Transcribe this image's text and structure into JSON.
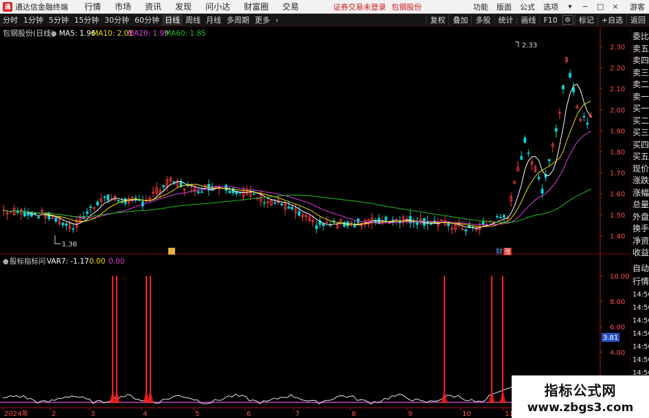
{
  "window": {
    "app_title": "通达信金融终端",
    "menu": [
      "行情",
      "市场",
      "资讯",
      "发现",
      "问小达",
      "财富圈",
      "交易"
    ],
    "notice": "证券交易未登录",
    "stock_name": "包钢股份",
    "right_menu": [
      "功能",
      "版面",
      "公式",
      "选项"
    ],
    "guest_label": "游客"
  },
  "toolbar": {
    "periods": [
      "分时",
      "1分钟",
      "5分钟",
      "15分钟",
      "30分钟",
      "60分钟",
      "日线",
      "周线",
      "月线",
      "多周期",
      "更多"
    ],
    "active_period": "日线",
    "right_buttons": [
      "复权",
      "叠加",
      "多股",
      "统计",
      "画线",
      "F10",
      "标记",
      "+自选",
      "返回"
    ]
  },
  "price_chart": {
    "header_name": "包钢股份(日线)",
    "ma_labels": [
      {
        "text": "MA5: 1.96",
        "color": "#ffffff"
      },
      {
        "text": "MA10: 2.01",
        "color": "#f0e000"
      },
      {
        "text": "MA20: 1.99",
        "color": "#e040e0"
      },
      {
        "text": "MA60: 1.85",
        "color": "#20c020"
      }
    ],
    "high_label": "2.33",
    "low_label": "1.36",
    "y_ticks": [
      "2.30",
      "2.20",
      "2.10",
      "2.00",
      "1.90",
      "1.80",
      "1.70",
      "1.60",
      "1.50",
      "1.40"
    ],
    "event_badges": [
      "财",
      "涨"
    ]
  },
  "indicator_chart": {
    "header_name": "股标指标问",
    "var_label": "VAR7: -1.17",
    "val2": "0.00",
    "val3": "0.00",
    "y_ticks": [
      "10.00",
      "8.00",
      "6.00",
      "4.00",
      "2.00"
    ],
    "current_value": "3.81",
    "x_ticks": [
      "2024年",
      "2",
      "3",
      "4",
      "5",
      "6",
      "7",
      "8",
      "9",
      "10",
      "11"
    ]
  },
  "side_panel": {
    "items": [
      "委比",
      "卖五",
      "卖四",
      "卖三",
      "卖二",
      "卖一",
      "买一",
      "买二",
      "买三",
      "买四",
      "买五",
      "现价",
      "涨跌",
      "涨幅",
      "总量",
      "外盘",
      "换手",
      "净资",
      "收益"
    ],
    "lower_items": [
      "自动",
      "行情",
      "14:50",
      "14:50",
      "14:50",
      "14:50",
      "14:50",
      "14:50",
      "14:50",
      "14:50"
    ]
  },
  "watermark": {
    "title": "指标公式网",
    "url": "www.zbgs3.com"
  },
  "colors": {
    "up": "#ff3b3b",
    "down": "#00d8d8",
    "ma5": "#ffffff",
    "ma10": "#f0e000",
    "ma20": "#e040e0",
    "ma60": "#20c020",
    "grid": "#5a0000",
    "axis": "#b01818"
  }
}
